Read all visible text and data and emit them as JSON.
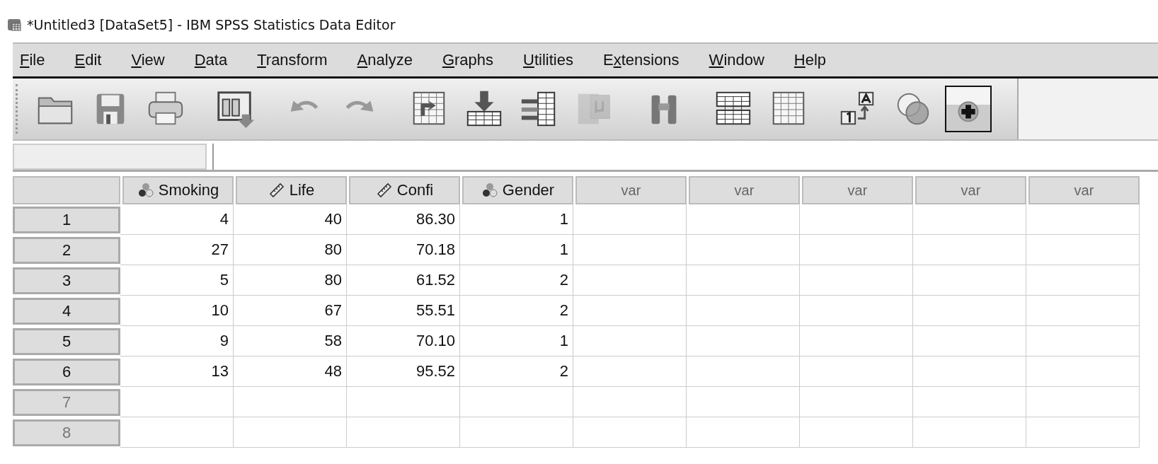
{
  "window": {
    "title": "*Untitled3 [DataSet5] - IBM SPSS Statistics Data Editor"
  },
  "menu": [
    {
      "key": "F",
      "rest": "ile"
    },
    {
      "key": "E",
      "rest": "dit"
    },
    {
      "key": "V",
      "rest": "iew"
    },
    {
      "key": "D",
      "rest": "ata"
    },
    {
      "key": "T",
      "rest": "ransform"
    },
    {
      "key": "A",
      "rest": "nalyze"
    },
    {
      "key": "G",
      "rest": "raphs"
    },
    {
      "key": "U",
      "rest": "tilities"
    },
    {
      "before": "E",
      "key": "x",
      "rest": "tensions"
    },
    {
      "key": "W",
      "rest": "indow"
    },
    {
      "key": "H",
      "rest": "elp"
    }
  ],
  "toolbar": [
    {
      "kind": "open",
      "disabled": false,
      "selected": false
    },
    {
      "kind": "save",
      "disabled": false,
      "selected": false
    },
    {
      "kind": "print",
      "disabled": false,
      "selected": false
    },
    {
      "kind": "goto",
      "disabled": false,
      "selected": false
    },
    {
      "kind": "undo",
      "disabled": false,
      "selected": false
    },
    {
      "kind": "redo",
      "disabled": false,
      "selected": false
    },
    {
      "kind": "recall",
      "disabled": false,
      "selected": false
    },
    {
      "kind": "insert",
      "disabled": false,
      "selected": false
    },
    {
      "kind": "variables",
      "disabled": false,
      "selected": false
    },
    {
      "kind": "mu",
      "disabled": true,
      "selected": false
    },
    {
      "kind": "find",
      "disabled": false,
      "selected": false
    },
    {
      "kind": "split",
      "disabled": false,
      "selected": false
    },
    {
      "kind": "select",
      "disabled": false,
      "selected": false
    },
    {
      "kind": "labels",
      "disabled": false,
      "selected": false
    },
    {
      "kind": "sets",
      "disabled": false,
      "selected": false
    },
    {
      "kind": "customize",
      "disabled": false,
      "selected": true
    }
  ],
  "table": {
    "columns": [
      {
        "label": "Smoking",
        "kind": "nominal"
      },
      {
        "label": "Life",
        "kind": "scale"
      },
      {
        "label": "Confi",
        "kind": "scale"
      },
      {
        "label": "Gender",
        "kind": "nominal"
      },
      {
        "label": "var",
        "kind": "empty"
      },
      {
        "label": "var",
        "kind": "empty"
      },
      {
        "label": "var",
        "kind": "empty"
      },
      {
        "label": "var",
        "kind": "empty"
      },
      {
        "label": "var",
        "kind": "empty"
      }
    ],
    "rows": [
      {
        "number": "1",
        "empty": false,
        "cells": [
          "4",
          "40",
          "86.30",
          "1"
        ]
      },
      {
        "number": "2",
        "empty": false,
        "cells": [
          "27",
          "80",
          "70.18",
          "1"
        ]
      },
      {
        "number": "3",
        "empty": false,
        "cells": [
          "5",
          "80",
          "61.52",
          "2"
        ]
      },
      {
        "number": "4",
        "empty": false,
        "cells": [
          "10",
          "67",
          "55.51",
          "2"
        ]
      },
      {
        "number": "5",
        "empty": false,
        "cells": [
          "9",
          "58",
          "70.10",
          "1"
        ]
      },
      {
        "number": "6",
        "empty": false,
        "cells": [
          "13",
          "48",
          "95.52",
          "2"
        ]
      },
      {
        "number": "7",
        "empty": true,
        "cells": []
      },
      {
        "number": "8",
        "empty": true,
        "cells": []
      }
    ]
  }
}
